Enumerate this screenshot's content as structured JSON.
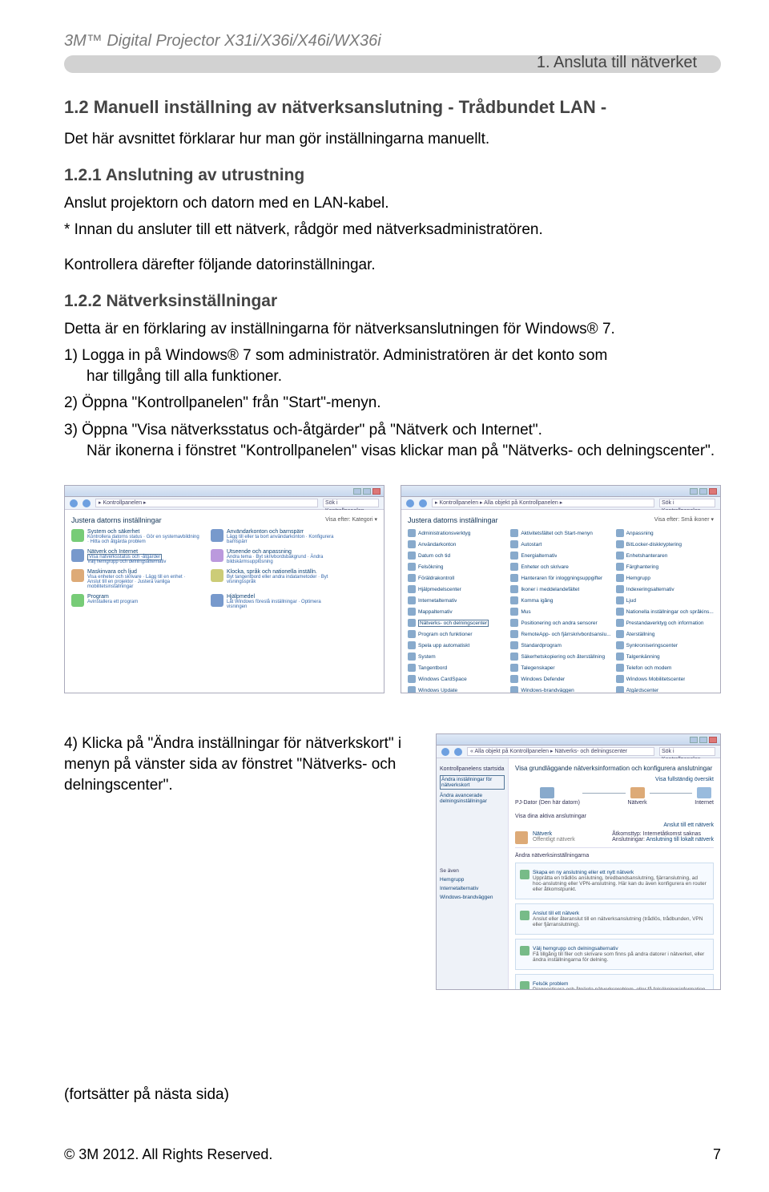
{
  "header": {
    "product": "3M™ Digital Projector X31i/X36i/X46i/WX36i"
  },
  "breadcrumb_bar": {
    "chapter": "1. Ansluta till nätverket"
  },
  "s12": {
    "title": "1.2 Manuell inställning av nätverksanslutning - Trådbundet LAN -",
    "intro": "Det här avsnittet förklarar hur man gör inställningarna manuellt."
  },
  "s121": {
    "title": "1.2.1 Anslutning av utrustning",
    "p1": "Anslut projektorn och datorn med en LAN-kabel.",
    "p2": "* Innan du ansluter till ett nätverk, rådgör med nätverksadministratören.",
    "p3": "Kontrollera därefter följande datorinställningar."
  },
  "s122": {
    "title": "1.2.2 Nätverksinställningar",
    "intro": "Detta är en förklaring av inställningarna för nätverksanslutningen för Windows® 7.",
    "step1a": "1) Logga in på Windows® 7 som administratör. Administratören är det konto som",
    "step1b": "har tillgång till alla funktioner.",
    "step2": "2) Öppna \"Kontrollpanelen\" från \"Start\"-menyn.",
    "step3a": "3) Öppna \"Visa nätverksstatus och-åtgärder\" på \"Nätverk och Internet\".",
    "step3b": "När ikonerna i fönstret \"Kontrollpanelen\" visas klickar man på \"Nätverks- och delningscenter\".",
    "step4": "4) Klicka på \"Ändra inställningar för nätverkskort\" i menyn på vänster sida av fönstret \"Nätverks- och delningscenter\"."
  },
  "shot_cp_category": {
    "crumb": "▸ Kontrollpanelen ▸",
    "search": "Sök i Kontrollpanelen",
    "heading": "Justera datorns inställningar",
    "view": "Visa efter: Kategori ▾",
    "cats": [
      {
        "t": "System och säkerhet",
        "s": "Kontrollera datorns status · Gör en systemavbildning · Hitta och åtgärda problem"
      },
      {
        "t": "Användarkonton och barnspärr",
        "s": "Lägg till eller ta bort användarkonton · Konfigurera barnspärr"
      },
      {
        "t": "Nätverk och Internet",
        "s": "Visa nätverksstatus och -åtgärder · Välj hemgrupp och delningsalternativ",
        "hl": true
      },
      {
        "t": "Utseende och anpassning",
        "s": "Ändra tema · Byt skrivbordsbakgrund · Ändra bildskärmsupplösning"
      },
      {
        "t": "Maskinvara och ljud",
        "s": "Visa enheter och skrivare · Lägg till en enhet · Anslut till en projektor · Justera vanliga mobilitetsinställningar"
      },
      {
        "t": "Klocka, språk och nationella inställn.",
        "s": "Byt tangentbord eller andra indatametoder · Byt visningsspråk"
      },
      {
        "t": "Program",
        "s": "Avinstallera ett program"
      },
      {
        "t": "Hjälpmedel",
        "s": "Låt Windows föreslå inställningar · Optimera visningen"
      }
    ]
  },
  "shot_cp_icons": {
    "crumb": "▸ Kontrollpanelen ▸ Alla objekt på Kontrollpanelen ▸",
    "search": "Sök i Kontrollpanelen",
    "heading": "Justera datorns inställningar",
    "view": "Visa efter: Små ikoner ▾",
    "items": [
      "Administrationsverktyg",
      "Aktivitetsfältet och Start-menyn",
      "Anpassning",
      "Användarkonton",
      "Autostart",
      "BitLocker-diskkryptering",
      "Datum och tid",
      "Energialternativ",
      "Enhetshanteraren",
      "Felsökning",
      "Enheter och skrivare",
      "Färghantering",
      "Föräldrakontroll",
      "Hanteraren för inloggningsuppgifter",
      "Hemgrupp",
      "Hjälpmedelscenter",
      "Ikoner i meddelandefältet",
      "Indexeringsalternativ",
      "Internetalternativ",
      "Komma igång",
      "Ljud",
      "Mappalternativ",
      "Mus",
      "Nationella inställningar och språkins...",
      "Nätverks- och delningscenter",
      "Positionering och andra sensorer",
      "Prestandaverktyg och information",
      "Program och funktioner",
      "RemoteApp- och fjärrskrivbordsanslu...",
      "Återställning",
      "Spela upp automatiskt",
      "Standardprogram",
      "Synkroniseringscenter",
      "System",
      "Säkerhetskopiering och återställning",
      "Talgenkänning",
      "Tangentbord",
      "Talegenskaper",
      "Telefon och modem",
      "Windows CardSpace",
      "Windows Defender",
      "Windows Mobilitetscenter",
      "Windows Update",
      "Windows-brandväggen",
      "Åtgärdscenter"
    ]
  },
  "shot_ns": {
    "crumb": "« Alla objekt på Kontrollpanelen ▸ Nätverks- och delningscenter",
    "search": "Sök i Kontrollpanelen",
    "side_title": "Kontrollpanelens startsida",
    "side_links": [
      "Ändra inställningar för nätverkskort",
      "Ändra avancerade delningsinställningar"
    ],
    "side_more": "Se även",
    "side_more_items": [
      "Hemgrupp",
      "Internetalternativ",
      "Windows-brandväggen"
    ],
    "main_h": "Visa grundläggande nätverksinformation och konfigurera anslutningar",
    "map_link": "Visa fullständig översikt",
    "nodes": [
      "PJ-Dator (Den här datorn)",
      "Nätverk",
      "Internet"
    ],
    "active_h": "Visa dina aktiva anslutningar",
    "active_link": "Anslut till ett nätverk",
    "conn_name": "Nätverk",
    "conn_sub": "Offentligt nätverk",
    "conn_at": "Åtkomsttyp:",
    "conn_at_v": "Internetåtkomst saknas",
    "conn_c": "Anslutningar:",
    "conn_c_v": "Anslutning till lokalt nätverk",
    "change_h": "Ändra nätverksinställningarna",
    "boxes": [
      {
        "t": "Skapa en ny anslutning eller ett nytt nätverk",
        "s": "Upprätta en trådlös anslutning, bredbandsanslutning, fjärranslutning, ad hoc-anslutning eller VPN-anslutning. Här kan du även konfigurera en router eller åtkomstpunkt."
      },
      {
        "t": "Anslut till ett nätverk",
        "s": "Anslut eller återanslut till en nätverksanslutning (trådlös, trådbunden, VPN eller fjärranslutning)."
      },
      {
        "t": "Välj hemgrupp och delningsalternativ",
        "s": "Få tillgång till filer och skrivare som finns på andra datorer i nätverket, eller ändra inställningarna för delning."
      },
      {
        "t": "Felsök problem",
        "s": "Diagnostisera och åtgärda nätverksproblem, eller få felsökningsinformation."
      }
    ]
  },
  "continues": "(fortsätter på nästa sida)",
  "footer": {
    "copyright": "© 3M 2012. All Rights Reserved.",
    "page": "7"
  }
}
